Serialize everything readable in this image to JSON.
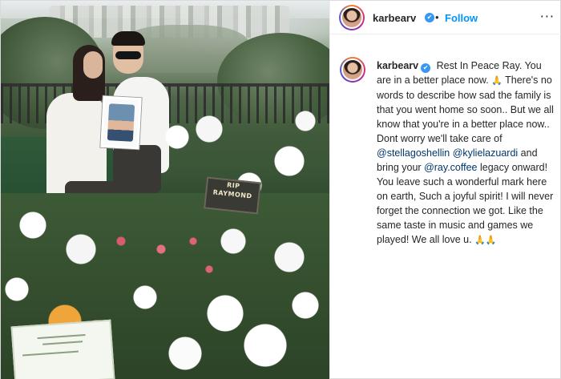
{
  "header": {
    "username": "karbearv",
    "dot": "•",
    "follow_label": "Follow",
    "more_label": "···"
  },
  "post": {
    "username": "karbearv",
    "caption_parts": {
      "p1": "Rest In Peace Ray. You are in a better place now.",
      "e1": "🙏",
      "p2": "There's no words to describe how sad the family is that you went home so soon.. But we all know that you're in a better place now.. Dont worry we'll take care of",
      "m1": "@stellagoshellin",
      "m2": "@kylielazuardi",
      "p3": "and bring your",
      "m3": "@ray.coffee",
      "p4": "legacy onward! You leave such a wonderful mark here on earth, Such a joyful spirit! I will never forget the connection we got. Like the same taste in music and games we played! We all love u.",
      "e2": "🙏🙏"
    }
  },
  "photo": {
    "plaque_line1": "RIP",
    "plaque_line2": "RAYMOND"
  },
  "icons": {
    "verified": "✔"
  },
  "colors": {
    "follow": "#0095f6",
    "verified": "#3897f0",
    "mention": "#00376b"
  }
}
